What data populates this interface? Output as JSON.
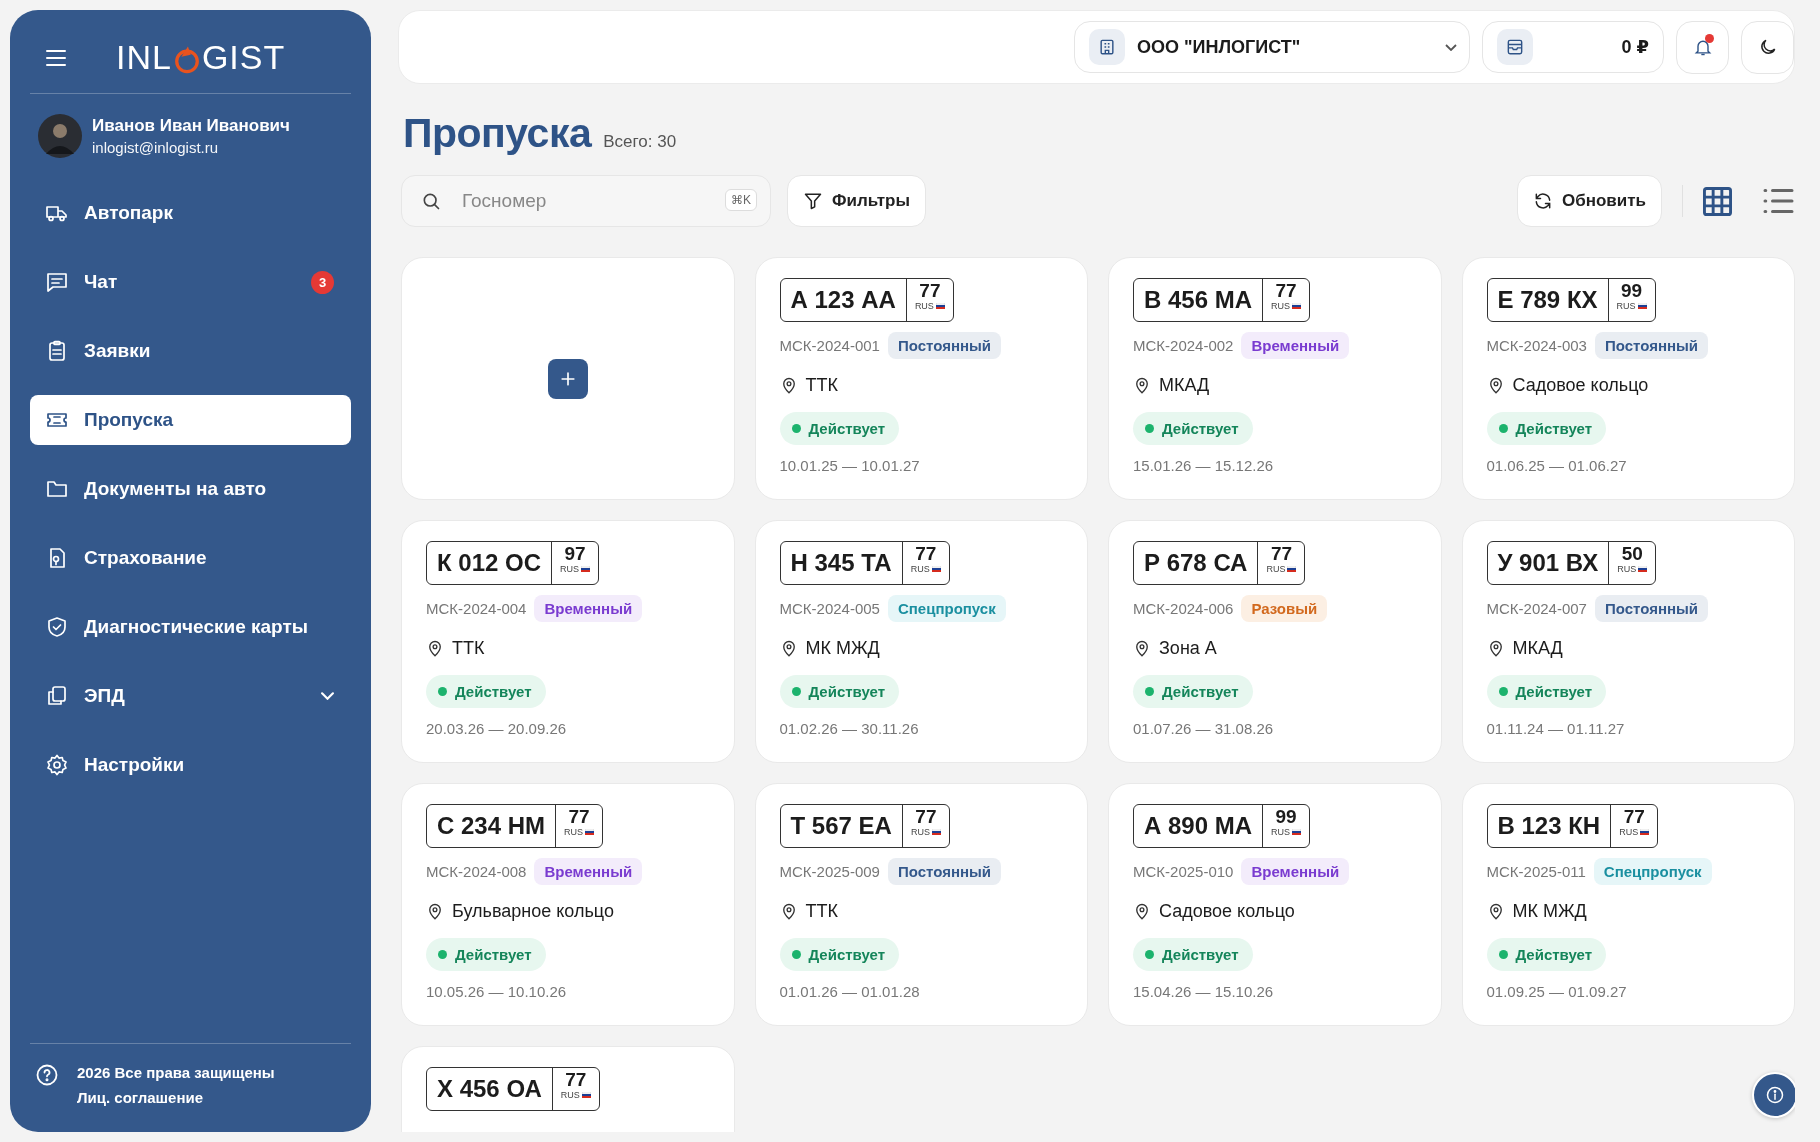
{
  "sidebar": {
    "logo": {
      "before": "INL",
      "after": "GIST"
    },
    "user": {
      "name": "Иванов Иван Иванович",
      "email": "inlogist@inlogist.ru"
    },
    "items": [
      {
        "label": "Автопарк",
        "kind": "truck",
        "selected": false
      },
      {
        "label": "Чат",
        "kind": "chat",
        "selected": false,
        "badge": "3"
      },
      {
        "label": "Заявки",
        "kind": "clipboard",
        "selected": false
      },
      {
        "label": "Пропуска",
        "kind": "ticket",
        "selected": true
      },
      {
        "label": "Документы на авто",
        "kind": "folder",
        "selected": false
      },
      {
        "label": "Страхование",
        "kind": "insurance",
        "selected": false
      },
      {
        "label": "Диагностические карты",
        "kind": "shield",
        "selected": false
      },
      {
        "label": "ЭПД",
        "kind": "copy",
        "selected": false,
        "expanded": false
      },
      {
        "label": "Настройки",
        "kind": "gear",
        "selected": false
      }
    ],
    "footer": {
      "copyright": "2026 Все права защищены",
      "link": "Лиц. соглашение"
    }
  },
  "header": {
    "company": "ООО \"ИНЛОГИСТ\"",
    "balance": "0 ₽",
    "has_notification": true
  },
  "page": {
    "title": "Пропуска",
    "total": "Всего: 30"
  },
  "toolbar": {
    "search_placeholder": "Госномер",
    "shortcut": "⌘K",
    "filters": "Фильтры",
    "refresh": "Обновить",
    "views": [
      {
        "kind": "grid",
        "selected": true
      },
      {
        "kind": "list",
        "selected": false
      }
    ]
  },
  "cards": [
    {
      "kind": "add"
    },
    {
      "kind": "pass",
      "plate": "А 123 АА",
      "region": "77",
      "country": "RUS",
      "code": "МСК-2024-001",
      "type": {
        "label": "Постоянный",
        "kind": "permanent"
      },
      "zone": "ТТК",
      "status": {
        "label": "Действует",
        "kind": "active"
      },
      "dates": "10.01.25 — 10.01.27"
    },
    {
      "kind": "pass",
      "plate": "В 456 МА",
      "region": "77",
      "country": "RUS",
      "code": "МСК-2024-002",
      "type": {
        "label": "Временный",
        "kind": "temporary"
      },
      "zone": "МКАД",
      "status": {
        "label": "Действует",
        "kind": "active"
      },
      "dates": "15.01.26 — 15.12.26"
    },
    {
      "kind": "pass",
      "plate": "Е 789 КХ",
      "region": "99",
      "country": "RUS",
      "code": "МСК-2024-003",
      "type": {
        "label": "Постоянный",
        "kind": "permanent"
      },
      "zone": "Садовое кольцо",
      "status": {
        "label": "Действует",
        "kind": "active"
      },
      "dates": "01.06.25 — 01.06.27"
    },
    {
      "kind": "pass",
      "plate": "К 012 ОС",
      "region": "97",
      "country": "RUS",
      "code": "МСК-2024-004",
      "type": {
        "label": "Временный",
        "kind": "temporary"
      },
      "zone": "ТТК",
      "status": {
        "label": "Действует",
        "kind": "active"
      },
      "dates": "20.03.26 — 20.09.26"
    },
    {
      "kind": "pass",
      "plate": "Н 345 ТА",
      "region": "77",
      "country": "RUS",
      "code": "МСК-2024-005",
      "type": {
        "label": "Спецпропуск",
        "kind": "special"
      },
      "zone": "МК МЖД",
      "status": {
        "label": "Действует",
        "kind": "active"
      },
      "dates": "01.02.26 — 30.11.26"
    },
    {
      "kind": "pass",
      "plate": "Р 678 СА",
      "region": "77",
      "country": "RUS",
      "code": "МСК-2024-006",
      "type": {
        "label": "Разовый",
        "kind": "onetime"
      },
      "zone": "Зона А",
      "status": {
        "label": "Действует",
        "kind": "active"
      },
      "dates": "01.07.26 — 31.08.26"
    },
    {
      "kind": "pass",
      "plate": "У 901 ВХ",
      "region": "50",
      "country": "RUS",
      "code": "МСК-2024-007",
      "type": {
        "label": "Постоянный",
        "kind": "permanent"
      },
      "zone": "МКАД",
      "status": {
        "label": "Действует",
        "kind": "active"
      },
      "dates": "01.11.24 — 01.11.27"
    },
    {
      "kind": "pass",
      "plate": "С 234 НМ",
      "region": "77",
      "country": "RUS",
      "code": "МСК-2024-008",
      "type": {
        "label": "Временный",
        "kind": "temporary"
      },
      "zone": "Бульварное кольцо",
      "status": {
        "label": "Действует",
        "kind": "active"
      },
      "dates": "10.05.26 — 10.10.26"
    },
    {
      "kind": "pass",
      "plate": "Т 567 ЕА",
      "region": "77",
      "country": "RUS",
      "code": "МСК-2025-009",
      "type": {
        "label": "Постоянный",
        "kind": "permanent"
      },
      "zone": "ТТК",
      "status": {
        "label": "Действует",
        "kind": "active"
      },
      "dates": "01.01.26 — 01.01.28"
    },
    {
      "kind": "pass",
      "plate": "А 890 МА",
      "region": "99",
      "country": "RUS",
      "code": "МСК-2025-010",
      "type": {
        "label": "Временный",
        "kind": "temporary"
      },
      "zone": "Садовое кольцо",
      "status": {
        "label": "Действует",
        "kind": "active"
      },
      "dates": "15.04.26 — 15.10.26"
    },
    {
      "kind": "pass",
      "plate": "В 123 КН",
      "region": "77",
      "country": "RUS",
      "code": "МСК-2025-011",
      "type": {
        "label": "Спецпропуск",
        "kind": "special"
      },
      "zone": "МК МЖД",
      "status": {
        "label": "Действует",
        "kind": "active"
      },
      "dates": "01.09.25 — 01.09.27"
    },
    {
      "kind": "pass",
      "plate": "Х 456 ОА",
      "region": "77",
      "country": "RUS"
    }
  ]
}
